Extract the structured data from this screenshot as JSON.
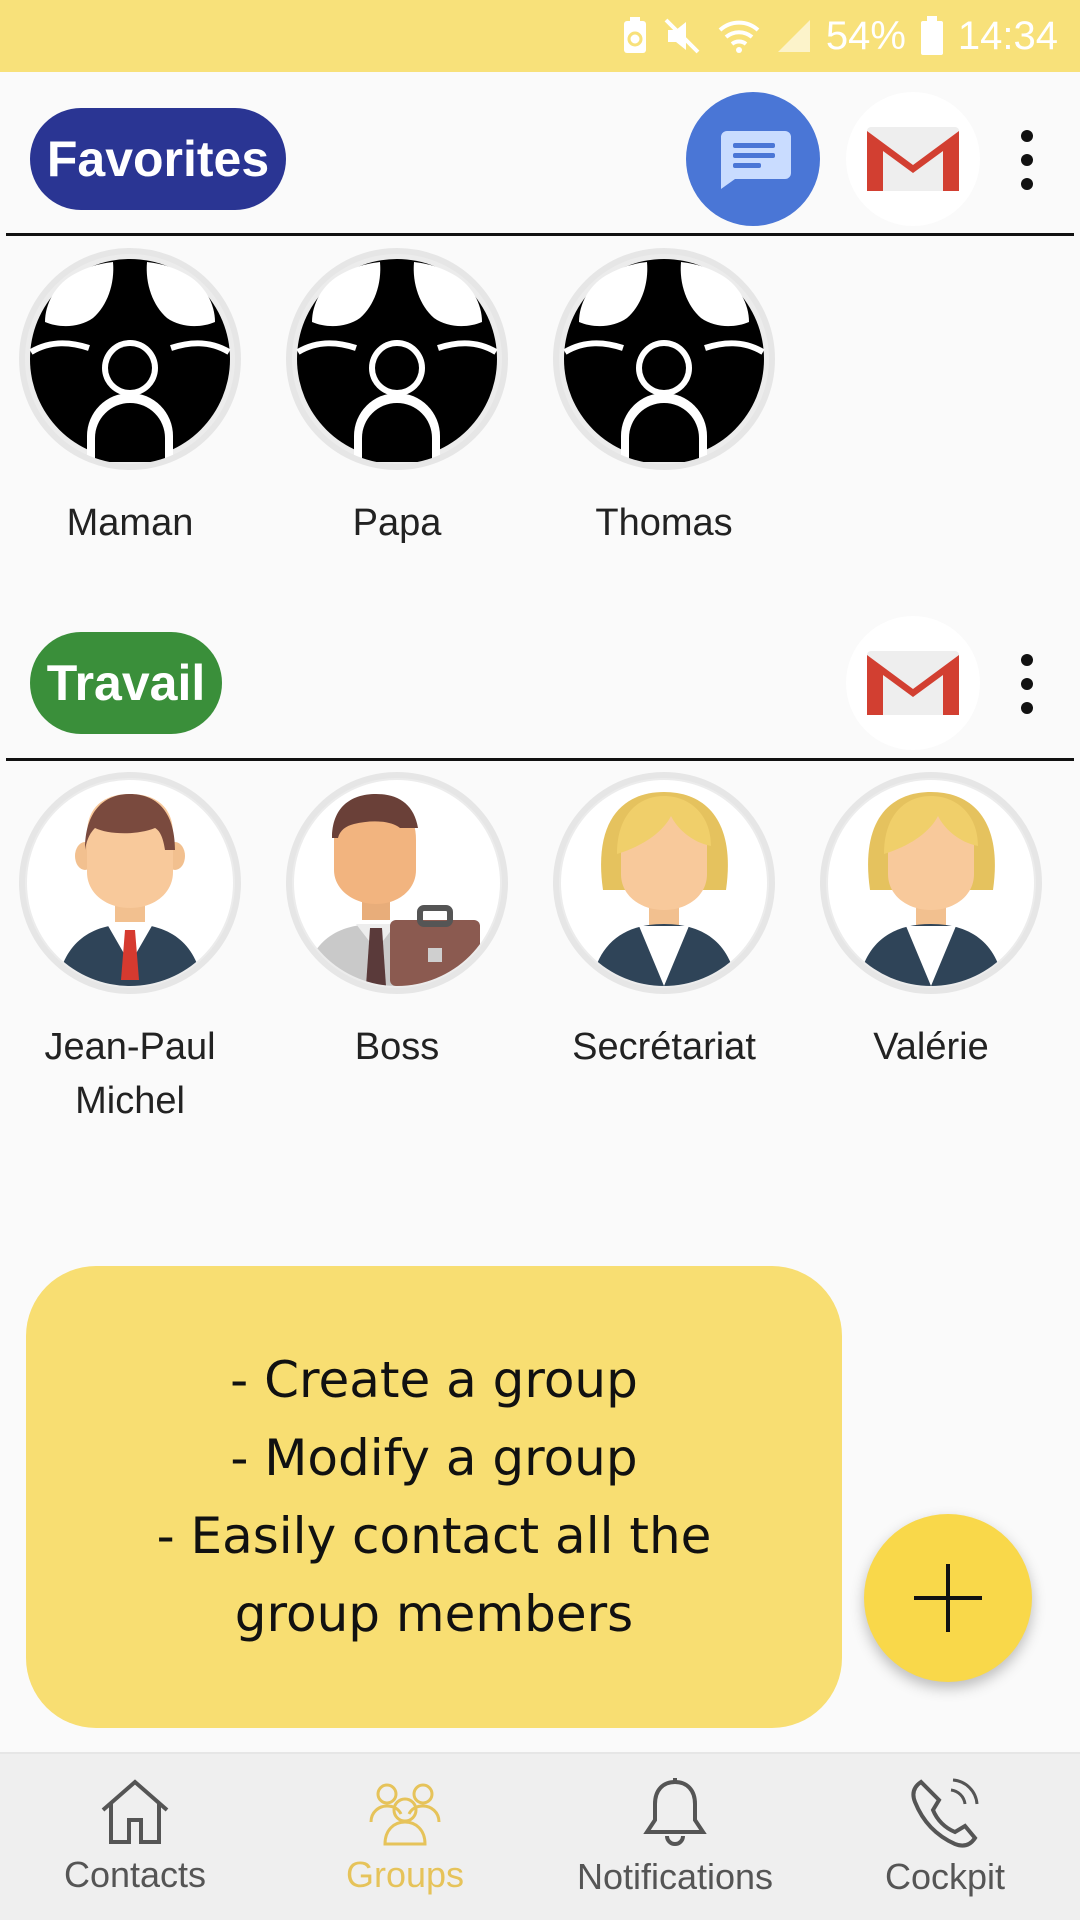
{
  "status_bar": {
    "battery_percent": "54%",
    "time": "14:34",
    "icons": [
      "battery-saver-icon",
      "mute-icon",
      "wifi-icon",
      "signal-icon",
      "battery-icon"
    ]
  },
  "groups": [
    {
      "name": "Favorites",
      "color": "#2a3593",
      "actions": [
        "messages-icon",
        "gmail-icon",
        "more-vert-icon"
      ],
      "contacts": [
        {
          "name": "Maman",
          "avatar": "group-avatar-icon"
        },
        {
          "name": "Papa",
          "avatar": "group-avatar-icon"
        },
        {
          "name": "Thomas",
          "avatar": "group-avatar-icon"
        }
      ]
    },
    {
      "name": "Travail",
      "color": "#3a8f3a",
      "actions": [
        "gmail-icon",
        "more-vert-icon"
      ],
      "contacts": [
        {
          "name_line1": "Jean-Paul",
          "name_line2": "Michel",
          "avatar": "businessman-avatar-icon"
        },
        {
          "name": "Boss",
          "avatar": "boss-avatar-icon"
        },
        {
          "name": "Secrétariat",
          "avatar": "businesswoman-avatar-icon"
        },
        {
          "name": "Valérie",
          "avatar": "businesswoman-avatar-icon"
        }
      ]
    }
  ],
  "info_bubble": {
    "line1": "- Create a group",
    "line2": "- Modify a group",
    "line3": "- Easily contact all the",
    "line4": "group members"
  },
  "fab": {
    "icon": "add-icon"
  },
  "bottom_nav": {
    "active": "Groups",
    "active_color": "#e6c35a",
    "items": [
      {
        "label": "Contacts",
        "icon": "home-icon"
      },
      {
        "label": "Groups",
        "icon": "groups-icon"
      },
      {
        "label": "Notifications",
        "icon": "bell-icon"
      },
      {
        "label": "Cockpit",
        "icon": "phone-icon"
      }
    ]
  }
}
